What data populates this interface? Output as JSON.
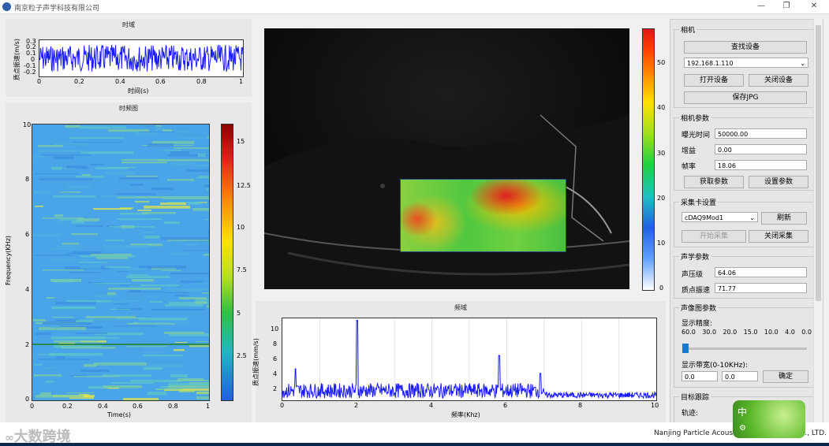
{
  "window": {
    "title": "南京粒子声学科技有限公司",
    "min": "—",
    "max": "❐",
    "close": "✕"
  },
  "time_domain": {
    "title": "时域",
    "xlabel": "时间(s)",
    "ylabel": "质点振速(m/s)",
    "yticks": [
      "0.3",
      "0.2",
      "0.1",
      "0",
      "-0.1",
      "-0.2"
    ],
    "xticks": [
      "0",
      "0.2",
      "0.4",
      "0.6",
      "0.8",
      "1"
    ]
  },
  "spectrogram": {
    "title": "时频图",
    "xlabel": "Time(s)",
    "ylabel": "Frequency(KHz)",
    "yticks": [
      "10",
      "8",
      "6",
      "4",
      "2",
      "0"
    ],
    "xticks": [
      "0",
      "0.2",
      "0.4",
      "0.6",
      "0.8",
      "1"
    ],
    "cbar_ticks": [
      "15",
      "12.5",
      "10",
      "7.5",
      "5",
      "2.5"
    ]
  },
  "image_cbar": {
    "ticks": [
      "50",
      "40",
      "30",
      "20",
      "10",
      "0"
    ]
  },
  "freq_domain": {
    "title": "频域",
    "xlabel": "频率(Khz)",
    "ylabel": "质点振速(mm/s)",
    "yticks": [
      "10",
      "8",
      "6",
      "4",
      "2"
    ],
    "xticks": [
      "0",
      "2",
      "4",
      "6",
      "8",
      "10"
    ]
  },
  "chart_data": {
    "type": "line",
    "title": "频域",
    "xlabel": "频率(Khz)",
    "ylabel": "质点振速(mm/s)",
    "xlim": [
      0,
      10
    ],
    "ylim": [
      0,
      11
    ],
    "peaks": [
      {
        "x": 2.0,
        "y": 10.7
      },
      {
        "x": 5.8,
        "y": 6.0
      },
      {
        "x": 0.35,
        "y": 4.2
      },
      {
        "x": 6.9,
        "y": 3.6
      }
    ]
  },
  "camera": {
    "label": "相机",
    "find": "查找设备",
    "ip": "192.168.1.110",
    "open": "打开设备",
    "close": "关闭设备",
    "save": "保存JPG"
  },
  "camera_params": {
    "label": "相机参数",
    "exposure_label": "曝光时间",
    "exposure": "50000.00",
    "gain_label": "增益",
    "gain": "0.00",
    "fps_label": "帧率",
    "fps": "18.06",
    "get": "获取参数",
    "set": "设置参数"
  },
  "daq": {
    "label": "采集卡设置",
    "device": "cDAQ9Mod1",
    "refresh": "刷新",
    "start": "开始采集",
    "stop": "关闭采集"
  },
  "acoustic": {
    "label": "声学参数",
    "spl_label": "声压级",
    "spl": "64.06",
    "vel_label": "质点振速",
    "vel": "71.77"
  },
  "image_params": {
    "label": "声像图参数",
    "precision_label": "显示精度:",
    "precision_values": [
      "60.0",
      "30.0",
      "20.0",
      "15.0",
      "10.0",
      "4.0",
      "0.0"
    ],
    "band_label": "显示带宽(0-10KHz):",
    "band_low": "0.0",
    "band_high": "0.0",
    "confirm": "确定"
  },
  "tracking": {
    "label": "目标跟踪",
    "track_label": "轨迹:"
  },
  "footer": {
    "brand": "Nanjing Particle Acous",
    "brand_end": "o., LTD.",
    "watermark": "大数跨境"
  }
}
